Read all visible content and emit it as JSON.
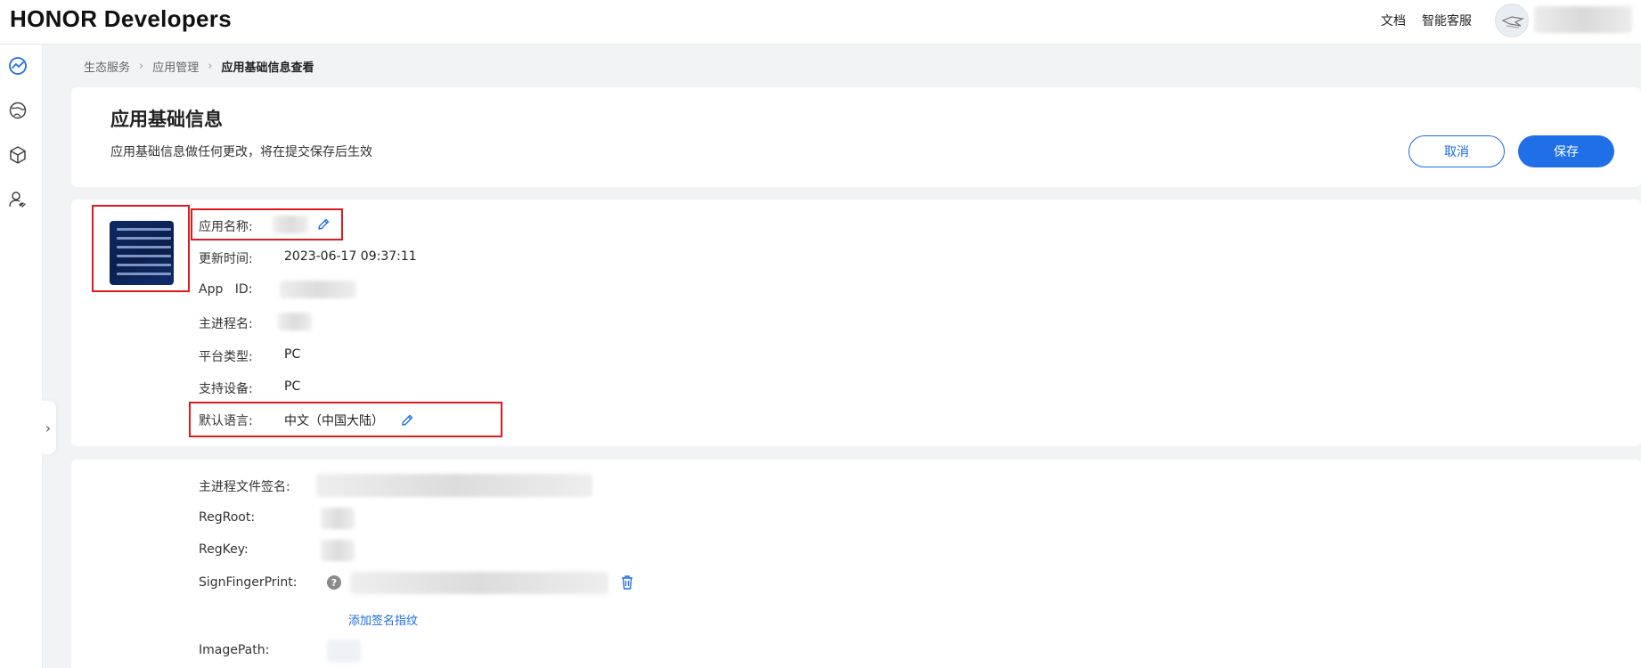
{
  "header": {
    "brand": "HONOR Developers",
    "links": [
      "文档",
      "智能客服"
    ]
  },
  "sidebar": {
    "icons": [
      "analytics-icon",
      "globe-icon",
      "cube-icon",
      "user-link-icon"
    ]
  },
  "breadcrumb": {
    "items": [
      "生态服务",
      "应用管理",
      "应用基础信息查看"
    ]
  },
  "page": {
    "title": "应用基础信息",
    "subtitle": "应用基础信息做任何更改，将在提交保存后生效",
    "cancel_label": "取消",
    "save_label": "保存"
  },
  "app_icon": {
    "lines": 6
  },
  "basic_info": {
    "app_name_label": "应用名称:",
    "update_time_label": "更新时间:",
    "update_time_value": "2023-06-17 09:37:11",
    "app_id_label": "App   ID:",
    "main_process_label": "主进程名:",
    "platform_label": "平台类型:",
    "platform_value": "PC",
    "devices_label": "支持设备:",
    "devices_value": "PC",
    "language_label": "默认语言:",
    "language_value": "中文（中国大陆）"
  },
  "signature_info": {
    "file_signature_label": "主进程文件签名:",
    "regroot_label": "RegRoot:",
    "regkey_label": "RegKey:",
    "fingerprint_label": "SignFingerPrint:",
    "help_glyph": "?",
    "add_fingerprint_label": "添加签名指纹",
    "imagepath_label": "ImagePath:"
  },
  "colors": {
    "primary": "#1f6fe8",
    "highlight_box": "#e0191e",
    "page_bg": "#f1f3f5"
  }
}
